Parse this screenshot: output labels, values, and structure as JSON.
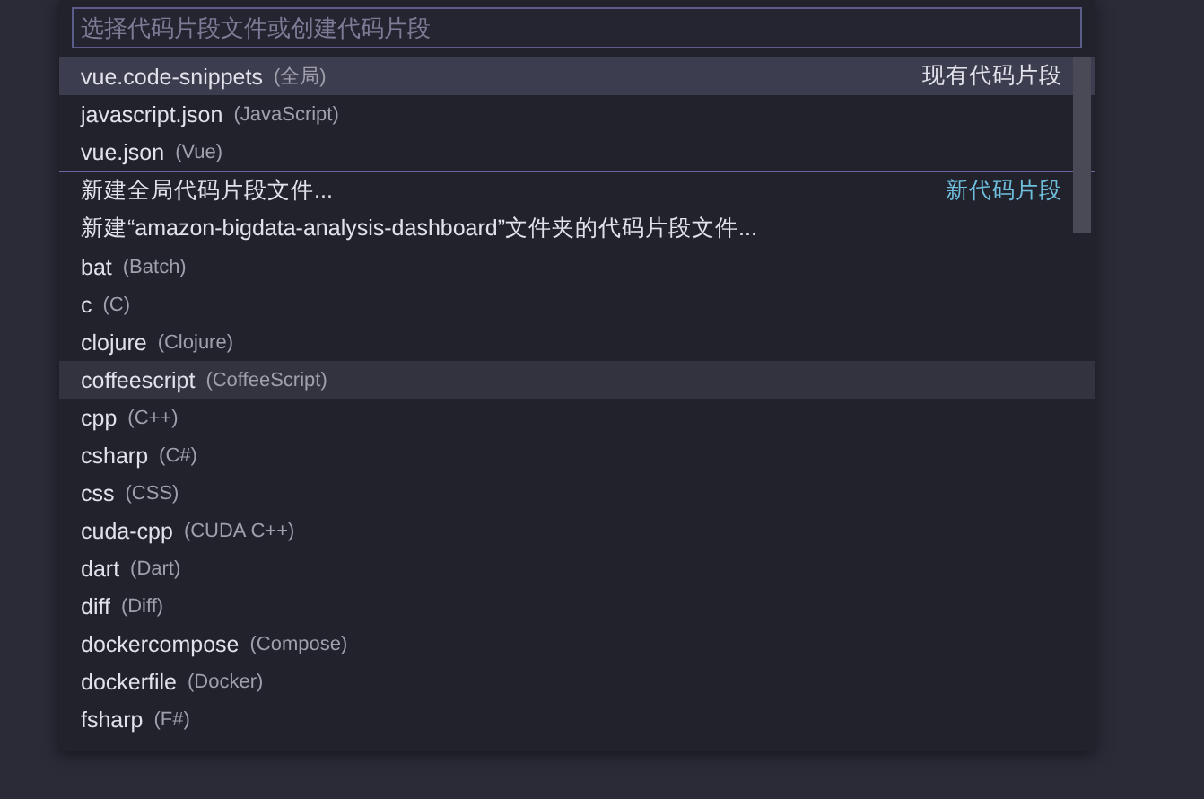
{
  "input": {
    "placeholder": "选择代码片段文件或创建代码片段"
  },
  "groups": [
    {
      "label": "现有代码片段",
      "items": [
        {
          "label": "vue.code-snippets",
          "description": "(全局)",
          "selected": true,
          "hovered": false
        },
        {
          "label": "javascript.json",
          "description": "(JavaScript)",
          "selected": false,
          "hovered": false
        },
        {
          "label": "vue.json",
          "description": "(Vue)",
          "selected": false,
          "hovered": false
        }
      ]
    },
    {
      "label": "新代码片段",
      "items": [
        {
          "label": "新建全局代码片段文件...",
          "selected": false,
          "hovered": false
        },
        {
          "label": "新建“amazon-bigdata-analysis-dashboard”文件夹的代码片段文件...",
          "selected": false,
          "hovered": false
        },
        {
          "label": "bat",
          "description": "(Batch)",
          "selected": false,
          "hovered": false
        },
        {
          "label": "c",
          "description": "(C)",
          "selected": false,
          "hovered": false
        },
        {
          "label": "clojure",
          "description": "(Clojure)",
          "selected": false,
          "hovered": false
        },
        {
          "label": "coffeescript",
          "description": "(CoffeeScript)",
          "selected": false,
          "hovered": true
        },
        {
          "label": "cpp",
          "description": "(C++)",
          "selected": false,
          "hovered": false
        },
        {
          "label": "csharp",
          "description": "(C#)",
          "selected": false,
          "hovered": false
        },
        {
          "label": "css",
          "description": "(CSS)",
          "selected": false,
          "hovered": false
        },
        {
          "label": "cuda-cpp",
          "description": "(CUDA C++)",
          "selected": false,
          "hovered": false
        },
        {
          "label": "dart",
          "description": "(Dart)",
          "selected": false,
          "hovered": false
        },
        {
          "label": "diff",
          "description": "(Diff)",
          "selected": false,
          "hovered": false
        },
        {
          "label": "dockercompose",
          "description": "(Compose)",
          "selected": false,
          "hovered": false
        },
        {
          "label": "dockerfile",
          "description": "(Docker)",
          "selected": false,
          "hovered": false
        },
        {
          "label": "fsharp",
          "description": "(F#)",
          "selected": false,
          "hovered": false
        }
      ]
    }
  ]
}
